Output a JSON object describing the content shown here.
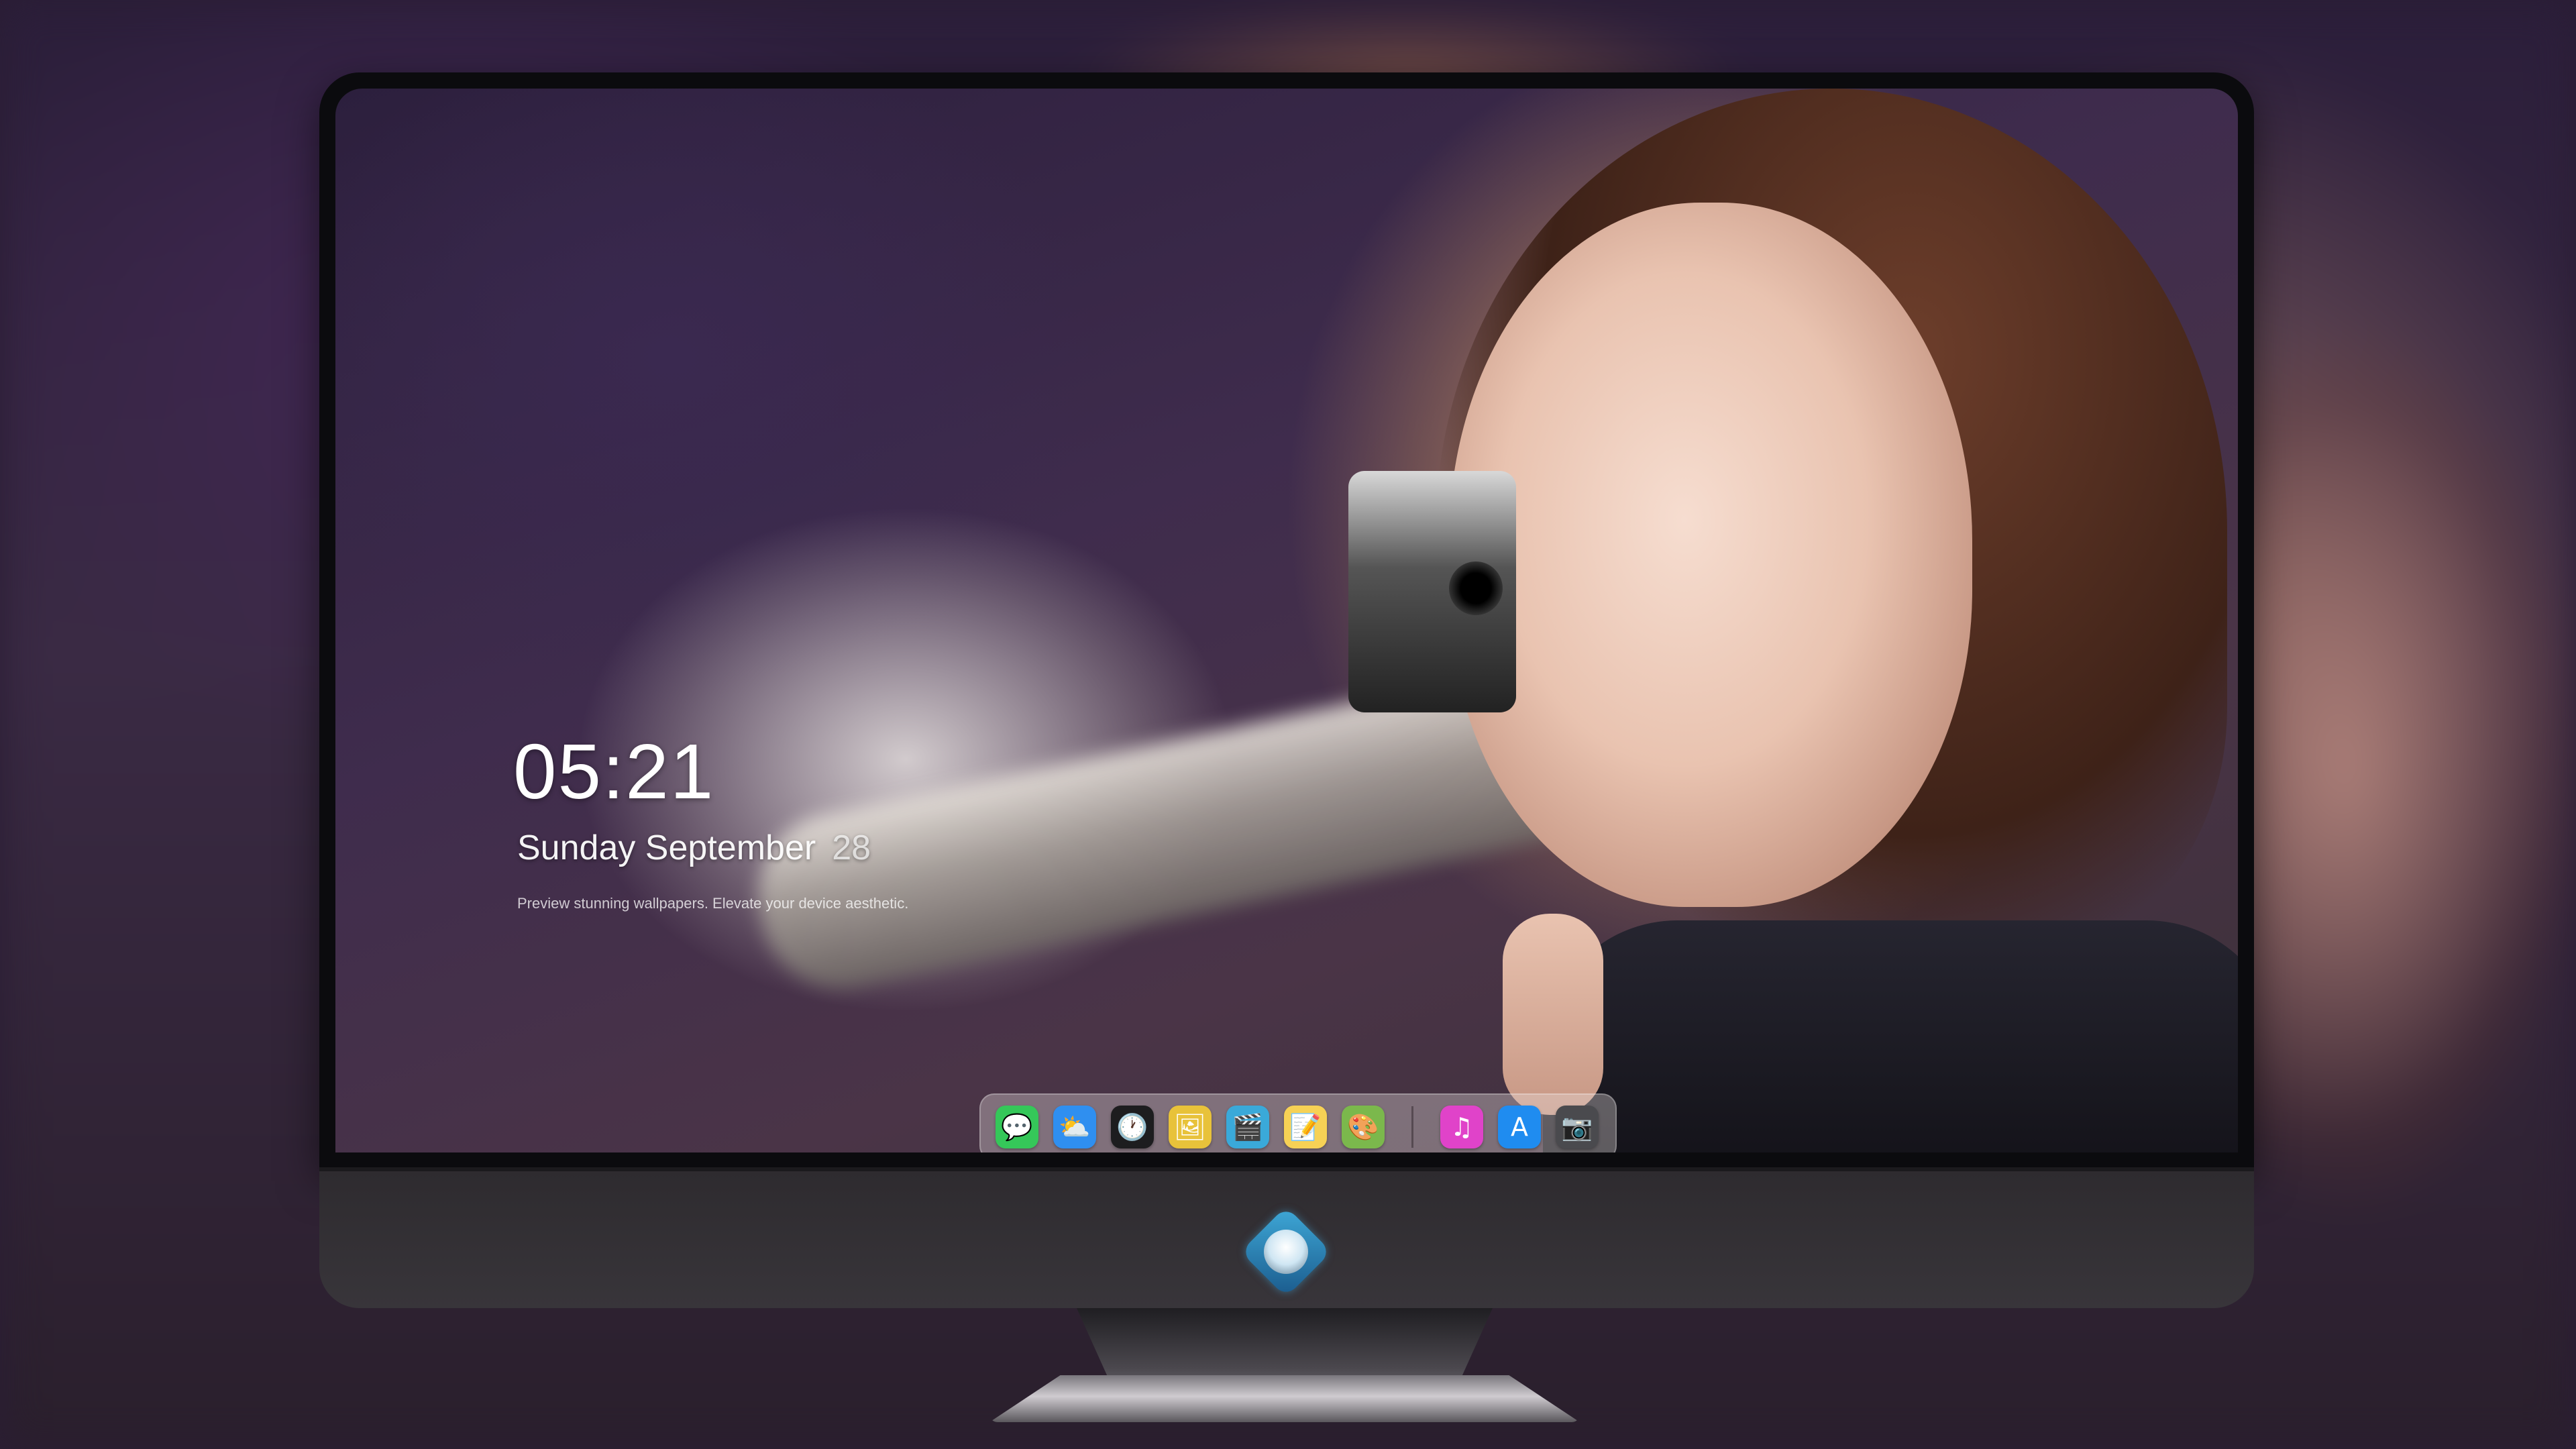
{
  "lock_screen": {
    "time": "05:21",
    "date": "Sunday September",
    "day": "28",
    "tagline": "Preview stunning wallpapers. Elevate your device aesthetic."
  },
  "dock": {
    "apps": [
      {
        "name": "messages",
        "icon": "messages-icon",
        "glyph": "💬",
        "color": "#35c759"
      },
      {
        "name": "weather",
        "icon": "weather-icon",
        "glyph": "⛅",
        "color": "#2f8ff0"
      },
      {
        "name": "clock",
        "icon": "clock-icon",
        "glyph": "🕐",
        "color": "#1d1d1f"
      },
      {
        "name": "preview",
        "icon": "preview-icon",
        "glyph": "🖼",
        "color": "#e8c23a"
      },
      {
        "name": "clips",
        "icon": "clapperboard-icon",
        "glyph": "🎬",
        "color": "#3aa9d9"
      },
      {
        "name": "notes",
        "icon": "notes-icon",
        "glyph": "📝",
        "color": "#f6d155"
      },
      {
        "name": "photo-booth",
        "icon": "photo-booth-icon",
        "glyph": "🎨",
        "color": "#7bb84c"
      },
      {
        "name": "music",
        "icon": "music-icon",
        "glyph": "♫",
        "color": "#e043c9"
      },
      {
        "name": "app-store",
        "icon": "app-store-icon",
        "glyph": "A",
        "color": "#1f8cf0"
      },
      {
        "name": "camera",
        "icon": "camera-icon",
        "glyph": "📷",
        "color": "#4a4a4e"
      }
    ],
    "separator_after": 7
  },
  "monitor": {
    "logo": "monitor-logo-icon",
    "accent": "#3fa9d8"
  }
}
